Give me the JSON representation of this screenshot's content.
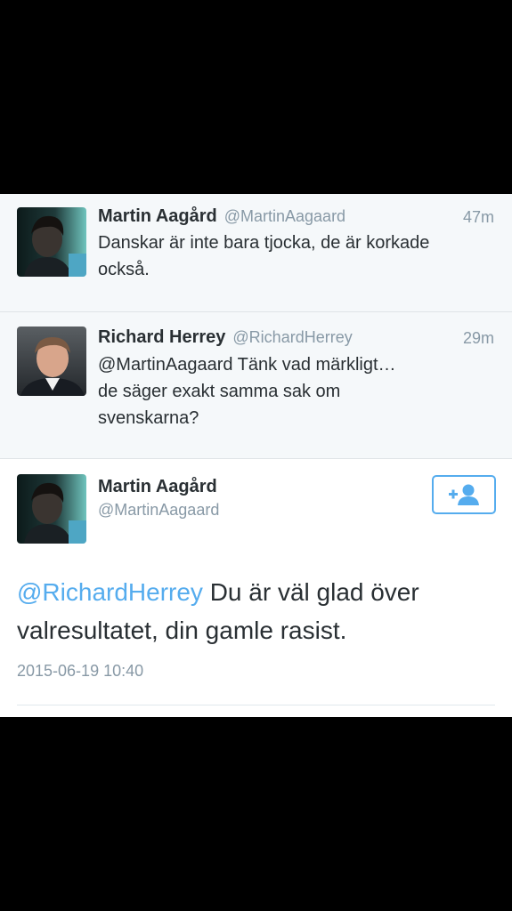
{
  "tweets": [
    {
      "name": "Martin Aagård",
      "handle": "@MartinAagaard",
      "time": "47m",
      "text": "Danskar är inte bara tjocka, de är korkade\nockså."
    },
    {
      "name": "Richard Herrey",
      "handle": "@RichardHerrey",
      "time": "29m",
      "text": "@MartinAagaard Tänk vad märkligt…\nde säger exakt samma sak om\nsvenskarna?"
    }
  ],
  "detail": {
    "name": "Martin Aagård",
    "handle": "@MartinAagaard",
    "mention": "@RichardHerrey",
    "text": " Du är väl glad över valresultatet, din gamle rasist.",
    "timestamp": "2015-06-19 10:40",
    "follow_icon": "add-user-icon"
  },
  "colors": {
    "link": "#55acee",
    "text": "#292f33",
    "muted": "#8899a6",
    "compact_bg": "#f5f8fa"
  }
}
